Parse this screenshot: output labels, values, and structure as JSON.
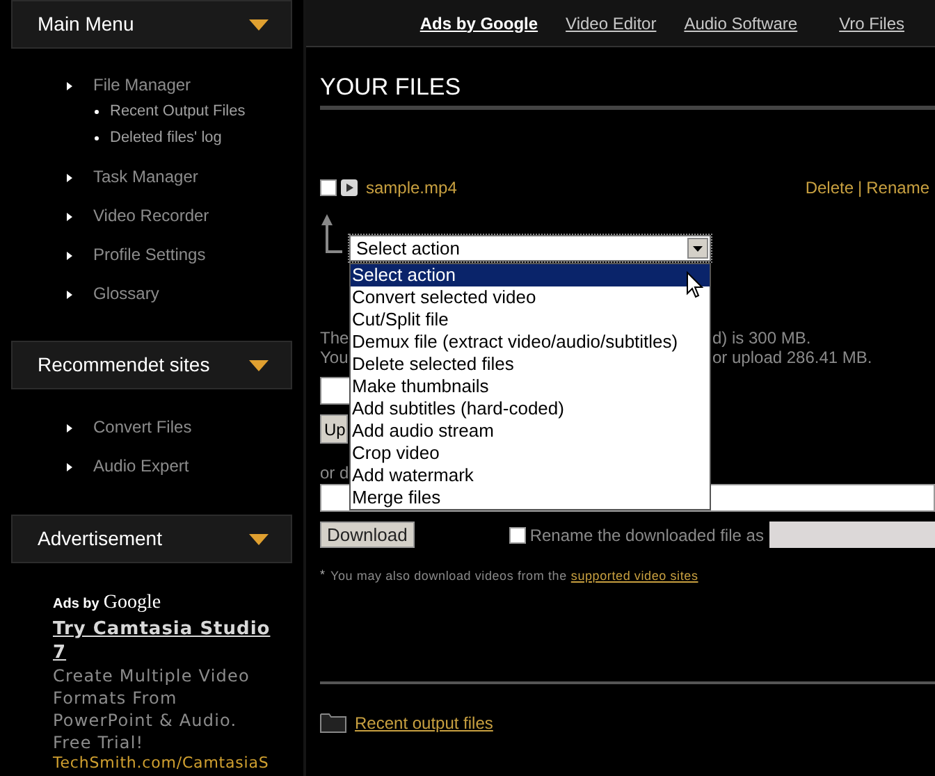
{
  "sidebar": [
    {
      "kind": "menu",
      "title": "Main Menu",
      "items": [
        {
          "label": "File Manager",
          "children": [
            {
              "label": "Recent Output Files"
            },
            {
              "label": "Deleted files' log"
            }
          ]
        },
        {
          "label": "Task Manager"
        },
        {
          "label": "Video Recorder"
        },
        {
          "label": "Profile Settings"
        },
        {
          "label": "Glossary"
        }
      ]
    },
    {
      "kind": "menu",
      "title": "Recommendet sites",
      "items": [
        {
          "label": "Convert Files"
        },
        {
          "label": "Audio Expert"
        }
      ]
    },
    {
      "kind": "ad",
      "title": "Advertisement",
      "ad": {
        "attribution_prefix": "Ads by",
        "attribution_brand": "Google",
        "headline": "Try Camtasia Studio 7",
        "body": "Create Multiple Video Formats From PowerPoint & Audio. Free Trial!",
        "url": "TechSmith.com/CamtasiaS"
      }
    }
  ],
  "top_nav": [
    {
      "label": "Ads by Google",
      "kind": "heading"
    },
    {
      "label": "Video Editor",
      "kind": "link"
    },
    {
      "label": "Audio Software",
      "kind": "link"
    },
    {
      "label": "Vro Files",
      "kind": "link"
    }
  ],
  "page_title": "YOUR FILES",
  "files": [
    {
      "name": "sample.mp4",
      "checked": false,
      "actions": [
        "Delete",
        "Rename"
      ],
      "action_separator": "|"
    }
  ],
  "action_select": {
    "value": "Select action",
    "expanded": true,
    "options": [
      {
        "label": "Select action",
        "selected": true
      },
      {
        "label": "Convert selected video",
        "selected": false
      },
      {
        "label": "Cut/Split file",
        "selected": false
      },
      {
        "label": "Demux file (extract video/audio/subtitles)",
        "selected": false
      },
      {
        "label": "Delete selected files",
        "selected": false
      },
      {
        "label": "Make thumbnails",
        "selected": false
      },
      {
        "label": "Add subtitles (hard-coded)",
        "selected": false
      },
      {
        "label": "Add audio stream",
        "selected": false
      },
      {
        "label": "Crop video",
        "selected": false
      },
      {
        "label": "Add watermark",
        "selected": false
      },
      {
        "label": "Merge files",
        "selected": false
      }
    ]
  },
  "info_lines": [
    {
      "left": "The",
      "right": "d) is 300 MB."
    },
    {
      "left": "You",
      "right": "or upload 286.41 MB."
    }
  ],
  "upload_button": "Up",
  "or_fragment": "or d",
  "download_button": "Download",
  "rename": {
    "checked": false,
    "label": "Rename the downloaded file as"
  },
  "note": {
    "mark": "*",
    "text": "You may also download videos from the",
    "link": "supported video sites"
  },
  "footer_link": "Recent output files"
}
